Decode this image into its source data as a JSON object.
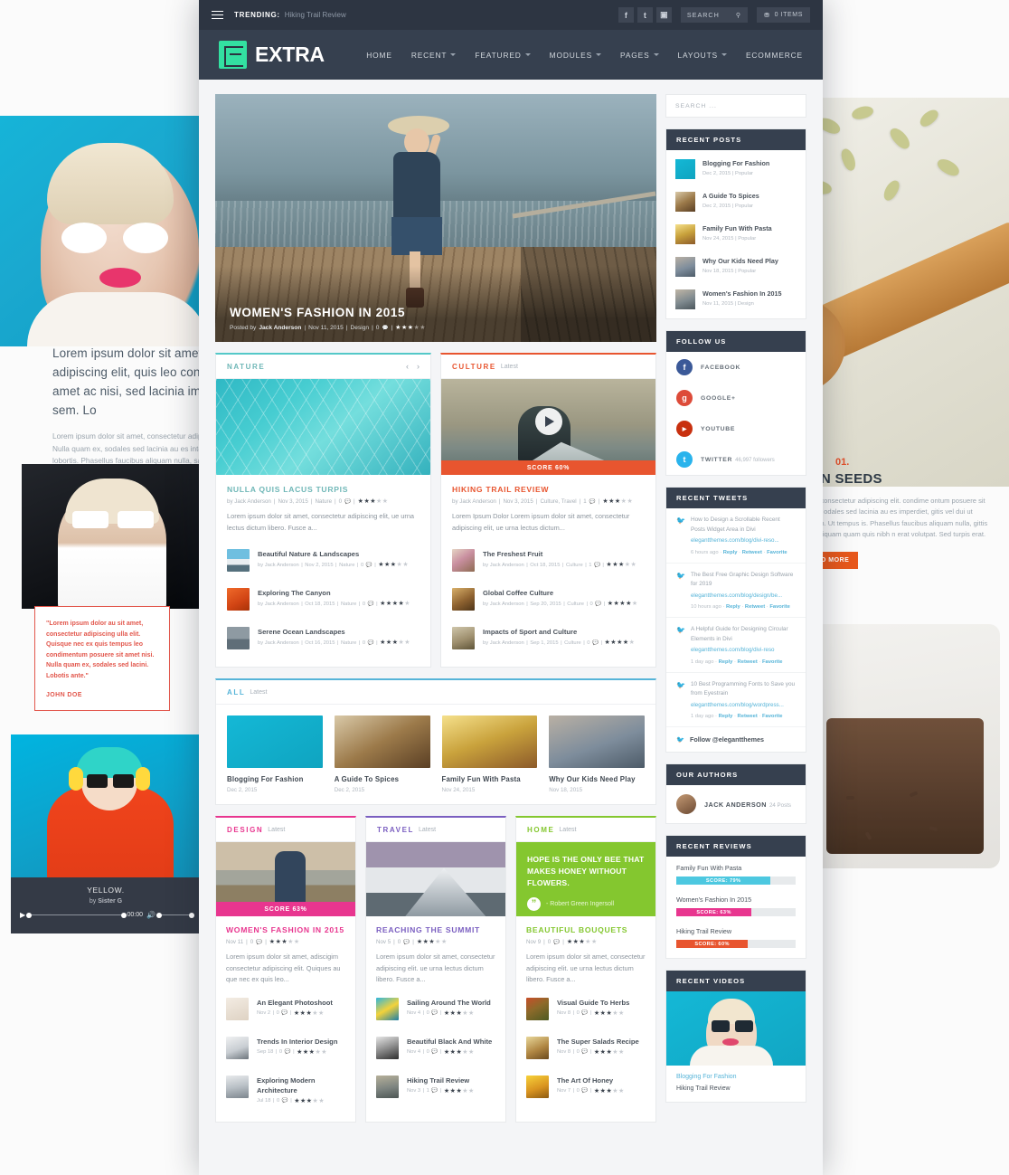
{
  "background": {
    "lead_paragraph": "Lorem ipsum dolor sit amet, consectetur adipiscing elit, quis leo condimentum posuere sit amet ac nisi, sed lacinia imperdiet, sodales at sem. Lo",
    "small_paragraph": "Lorem ipsum dolor sit amet, consectetur adipiscing elit, nunc sit amet ac nisi. Nulla quam ex, sodales sed lacinia au es interdum. Ut tempus ex vel sollicitudin lobortis. Phasellus faucibus aliquam nulla, sagittis porta. Aliquam quam quis nibh ante. Aliquam erat iaculis ut au sapien. Proin et ultrices ut leo et convallis.",
    "quote_text": "\"Lorem ipsum dolor au sit amet, consectetur adipiscing ulla elit. Quisque nec ex quis tempus leo condimentum posuere sit amet nisi. Nulla quam ex, sodales sed lacini. Lobotis ante.\"",
    "quote_author": "JOHN DOE",
    "audio_track": "YELLOW.",
    "audio_artist_prefix": "by",
    "audio_artist": "Sister G",
    "audio_time": "00:00",
    "right_number": "01.",
    "right_heading": "PKIN SEEDS",
    "right_paragraph": "t amet, consectetur adipiscing elit. condime ontum posuere sit amet ac odales sed lacinia au es imperdiet, gitis vel dui ut interdum. Ut tempus is. Phasellus faucibus aliquam nulla, gittis porta. Aliquam quam quis nibh n erat volutpat. Sed turpis erat.",
    "right_button": "READ MORE"
  },
  "topbar": {
    "trending_label": "TRENDING:",
    "trending_text": "Hiking Trail Review",
    "social": [
      {
        "name": "facebook-icon",
        "glyph": "f"
      },
      {
        "name": "twitter-icon",
        "glyph": "t"
      },
      {
        "name": "instagram-icon",
        "glyph": "▣"
      }
    ],
    "search_label": "SEARCH",
    "search_icon": "⚲",
    "cart_icon": "⛃",
    "cart_label": "0 ITEMS"
  },
  "brand": {
    "name": "EXTRA"
  },
  "nav": {
    "items": [
      {
        "label": "HOME",
        "has_caret": false
      },
      {
        "label": "RECENT",
        "has_caret": true
      },
      {
        "label": "FEATURED",
        "has_caret": true
      },
      {
        "label": "MODULES",
        "has_caret": true
      },
      {
        "label": "PAGES",
        "has_caret": true
      },
      {
        "label": "LAYOUTS",
        "has_caret": true
      },
      {
        "label": "ECOMMERCE",
        "has_caret": false
      }
    ]
  },
  "hero": {
    "title": "WOMEN'S FASHION IN 2015",
    "posted_by_prefix": "Posted by",
    "author": "Jack Anderson",
    "date": "Nov 11, 2015",
    "category": "Design",
    "comments": "0",
    "rating": 3
  },
  "modules": {
    "nature": {
      "title": "NATURE",
      "subtitle": "",
      "prev_icon": "‹",
      "next_icon": "›",
      "feature": {
        "title": "NULLA QUIS LACUS TURPIS",
        "byline": "by Jack Anderson",
        "date": "Nov 3, 2015",
        "category": "Nature",
        "comments": "0",
        "rating": 3,
        "excerpt": "Lorem ipsum dolor sit amet, consectetur adipiscing elit, ue urna lectus dictum libero. Fusce a..."
      },
      "posts": [
        {
          "title": "Beautiful Nature & Landscapes",
          "byline": "by Jack Anderson",
          "date": "Nov 2, 2015",
          "category": "Nature",
          "comments": "0",
          "rating": 3
        },
        {
          "title": "Exploring The Canyon",
          "byline": "by Jack Anderson",
          "date": "Oct 18, 2015",
          "category": "Nature",
          "comments": "0",
          "rating": 4
        },
        {
          "title": "Serene Ocean Landscapes",
          "byline": "by Jack Anderson",
          "date": "Oct 16, 2015",
          "category": "Nature",
          "comments": "0",
          "rating": 3
        }
      ]
    },
    "culture": {
      "title": "CULTURE",
      "subtitle": "Latest",
      "score_label": "SCORE 60%",
      "feature": {
        "title": "HIKING TRAIL REVIEW",
        "byline": "by Jack Anderson",
        "date": "Nov 3, 2015",
        "category": "Culture, Travel",
        "comments": "1",
        "rating": 3,
        "excerpt": "Lorem Ipsum Dolor Lorem ipsum dolor sit amet, consectetur adipiscing elit, ue urna lectus dictum..."
      },
      "posts": [
        {
          "title": "The Freshest Fruit",
          "byline": "by Jack Anderson",
          "date": "Oct 18, 2015",
          "category": "Culture",
          "comments": "1",
          "rating": 3
        },
        {
          "title": "Global Coffee Culture",
          "byline": "by Jack Anderson",
          "date": "Sep 20, 2015",
          "category": "Culture",
          "comments": "0",
          "rating": 4
        },
        {
          "title": "Impacts of Sport and Culture",
          "byline": "by Jack Anderson",
          "date": "Sep 1, 2015",
          "category": "Culture",
          "comments": "0",
          "rating": 4
        }
      ]
    },
    "all": {
      "title": "ALL",
      "subtitle": "Latest",
      "cards": [
        {
          "title": "Blogging For Fashion",
          "date": "Dec 2, 2015"
        },
        {
          "title": "A Guide To Spices",
          "date": "Dec 2, 2015"
        },
        {
          "title": "Family Fun With Pasta",
          "date": "Nov 24, 2015"
        },
        {
          "title": "Why Our Kids Need Play",
          "date": "Nov 18, 2015"
        }
      ]
    },
    "design": {
      "title": "DESIGN",
      "subtitle": "Latest",
      "score_label": "SCORE 63%",
      "feature": {
        "title": "WOMEN'S FASHION IN 2015",
        "date": "Nov 11",
        "comments": "0",
        "rating": 3,
        "excerpt": "Lorem ipsum dolor sit amet, adiscigim consectetur adipiscing elit. Quiques au que nec ex quis leo..."
      },
      "posts": [
        {
          "title": "An Elegant Photoshoot",
          "date": "Nov 2",
          "comments": "0",
          "rating": 3
        },
        {
          "title": "Trends In Interior Design",
          "date": "Sep 18",
          "comments": "0",
          "rating": 3
        },
        {
          "title": "Exploring Modern Architecture",
          "date": "Jul 18",
          "comments": "0",
          "rating": 3
        }
      ]
    },
    "travel": {
      "title": "TRAVEL",
      "subtitle": "Latest",
      "feature": {
        "title": "REACHING THE SUMMIT",
        "date": "Nov 5",
        "comments": "0",
        "rating": 3,
        "excerpt": "Lorem ipsum dolor sit amet, consectetur adipiscing elit. ue urna lectus dictum libero. Fusce a..."
      },
      "posts": [
        {
          "title": "Sailing Around The World",
          "date": "Nov 4",
          "comments": "0",
          "rating": 3
        },
        {
          "title": "Beautiful Black And White",
          "date": "Nov 4",
          "comments": "0",
          "rating": 3
        },
        {
          "title": "Hiking Trail Review",
          "date": "Nov 3",
          "comments": "1",
          "rating": 3
        }
      ]
    },
    "home": {
      "title": "HOME",
      "subtitle": "Latest",
      "quote": "HOPE IS THE ONLY BEE THAT MAKES HONEY WITHOUT FLOWERS.",
      "quote_mark": "”",
      "quote_author": "- Robert Green Ingersoll",
      "feature": {
        "title": "BEAUTIFUL BOUQUETS",
        "date": "Nov 9",
        "comments": "0",
        "rating": 3,
        "excerpt": "Lorem ipsum dolor sit amet, consectetur adipiscing elit. ue urna lectus dictum libero. Fusce a..."
      },
      "posts": [
        {
          "title": "Visual Guide To Herbs",
          "date": "Nov 8",
          "comments": "0",
          "rating": 3
        },
        {
          "title": "The Super Salads Recipe",
          "date": "Nov 8",
          "comments": "0",
          "rating": 3
        },
        {
          "title": "The Art Of Honey",
          "date": "Nov 7",
          "comments": "0",
          "rating": 3
        }
      ]
    }
  },
  "sidebar": {
    "search_placeholder": "SEARCH ...",
    "recent_posts": {
      "title": "RECENT POSTS",
      "items": [
        {
          "title": "Blogging For Fashion",
          "meta": "Dec 2, 2015 | Popular"
        },
        {
          "title": "A Guide To Spices",
          "meta": "Dec 2, 2015 | Popular"
        },
        {
          "title": "Family Fun With Pasta",
          "meta": "Nov 24, 2015 | Popular"
        },
        {
          "title": "Why Our Kids Need Play",
          "meta": "Nov 18, 2015 | Popular"
        },
        {
          "title": "Women's Fashion In 2015",
          "meta": "Nov 11, 2015 | Design"
        }
      ]
    },
    "follow_us": {
      "title": "FOLLOW US",
      "items": [
        {
          "name": "FACEBOOK",
          "sub": "",
          "glyph": "f",
          "color": "#3b5998"
        },
        {
          "name": "GOOGLE+",
          "sub": "",
          "glyph": "g",
          "color": "#dd4b39"
        },
        {
          "name": "YOUTUBE",
          "sub": "",
          "glyph": "▶",
          "color": "#c8300f"
        },
        {
          "name": "TWITTER",
          "sub": "46,997 followers",
          "glyph": "t",
          "color": "#29b3ec"
        }
      ]
    },
    "recent_tweets": {
      "title": "RECENT TWEETS",
      "items": [
        {
          "text": "How to Design a Scrollable Recent Posts Widget Area in Divi",
          "link": "elegantthemes.com/blog/divi-reso...",
          "time": "6 hours ago",
          "reply": "Reply",
          "retweet": "Retweet",
          "favorite": "Favorite"
        },
        {
          "text": "The Best Free Graphic Design Software for 2019",
          "link": "elegantthemes.com/blog/design/be...",
          "time": "10 hours ago",
          "reply": "Reply",
          "retweet": "Retweet",
          "favorite": "Favorite"
        },
        {
          "text": "A Helpful Guide for Designing Circular Elements in Divi",
          "link": "elegantthemes.com/blog/divi-reso",
          "time": "1 day ago",
          "reply": "Reply",
          "retweet": "Retweet",
          "favorite": "Favorite"
        },
        {
          "text": "10 Best Programming Fonts to Save you from Eyestrain",
          "link": "elegantthemes.com/blog/wordpress...",
          "time": "1 day ago",
          "reply": "Reply",
          "retweet": "Retweet",
          "favorite": "Favorite"
        }
      ],
      "follow_label": "Follow @elegantthemes"
    },
    "our_authors": {
      "title": "OUR AUTHORS",
      "author_name": "JACK ANDERSON",
      "author_posts": "24 Posts"
    },
    "recent_reviews": {
      "title": "RECENT REVIEWS",
      "items": [
        {
          "title": "Family Fun With Pasta",
          "score_label": "SCORE: 79%",
          "percent": 79,
          "color": "#4dc8e0"
        },
        {
          "title": "Women's Fashion In 2015",
          "score_label": "SCORE: 63%",
          "percent": 63,
          "color": "#e8368f"
        },
        {
          "title": "Hiking Trail Review",
          "score_label": "SCORE: 60%",
          "percent": 60,
          "color": "#e8552f"
        }
      ]
    },
    "recent_videos": {
      "title": "RECENT VIDEOS",
      "active": "Blogging For Fashion",
      "second": "Hiking Trail Review"
    }
  }
}
